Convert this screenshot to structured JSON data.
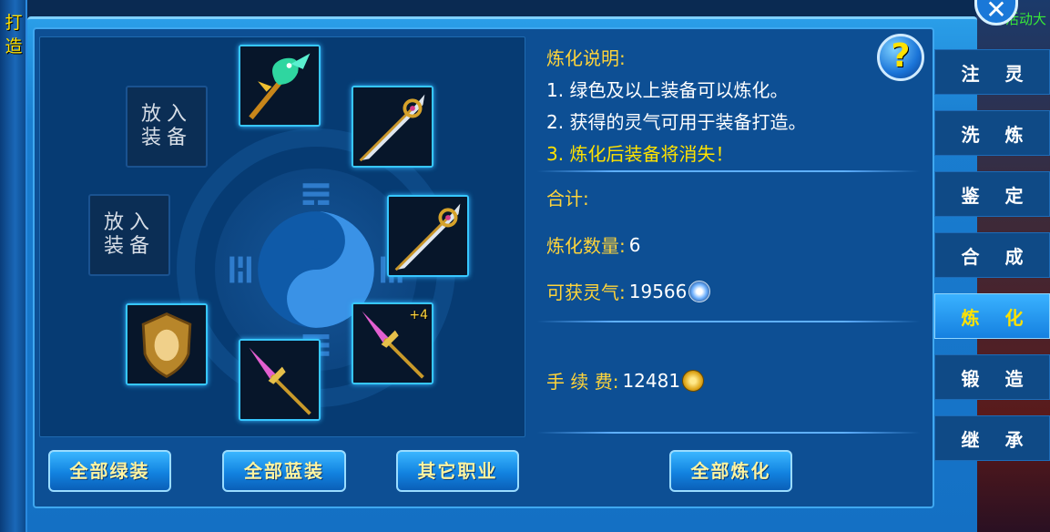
{
  "left_strip": {
    "title": "打造"
  },
  "top_right_text": "活动大",
  "close_label": "✕",
  "help_label": "?",
  "info": {
    "heading": "炼化说明:",
    "rules": [
      "1. 绿色及以上装备可以炼化。",
      "2. 获得的灵气可用于装备打造。"
    ],
    "warning": "3. 炼化后装备将消失！",
    "total_label": "合计:",
    "refine_count_label": "炼化数量:",
    "refine_count": "6",
    "aura_label": "可获灵气:",
    "aura_value": "19566",
    "fee_label": "手 续 费:",
    "fee_value": "12481"
  },
  "empty_slots": [
    {
      "line1": "放入",
      "line2": "装备"
    },
    {
      "line1": "放入",
      "line2": "装备"
    }
  ],
  "slots": [
    {
      "icon": "phoenix-staff-icon"
    },
    {
      "icon": "great-sword-icon"
    },
    {
      "icon": "great-sword-icon"
    },
    {
      "icon": "spear-icon",
      "plus": "+4"
    },
    {
      "icon": "spear-icon"
    },
    {
      "icon": "shield-icon"
    }
  ],
  "buttons": {
    "all_green": "全部绿装",
    "all_blue": "全部蓝装",
    "other_class": "其它职业",
    "refine_all": "全部炼化"
  },
  "tabs": [
    {
      "label": "注灵",
      "active": false
    },
    {
      "label": "洗炼",
      "active": false
    },
    {
      "label": "鉴定",
      "active": false
    },
    {
      "label": "合成",
      "active": false
    },
    {
      "label": "炼化",
      "active": true
    },
    {
      "label": "锻造",
      "active": false
    },
    {
      "label": "继承",
      "active": false
    }
  ],
  "colors": {
    "accent_gold": "#ffd43a",
    "warning_yellow": "#ffe200",
    "panel_blue": "#0d4f94",
    "slot_glow": "#37c7ff"
  }
}
